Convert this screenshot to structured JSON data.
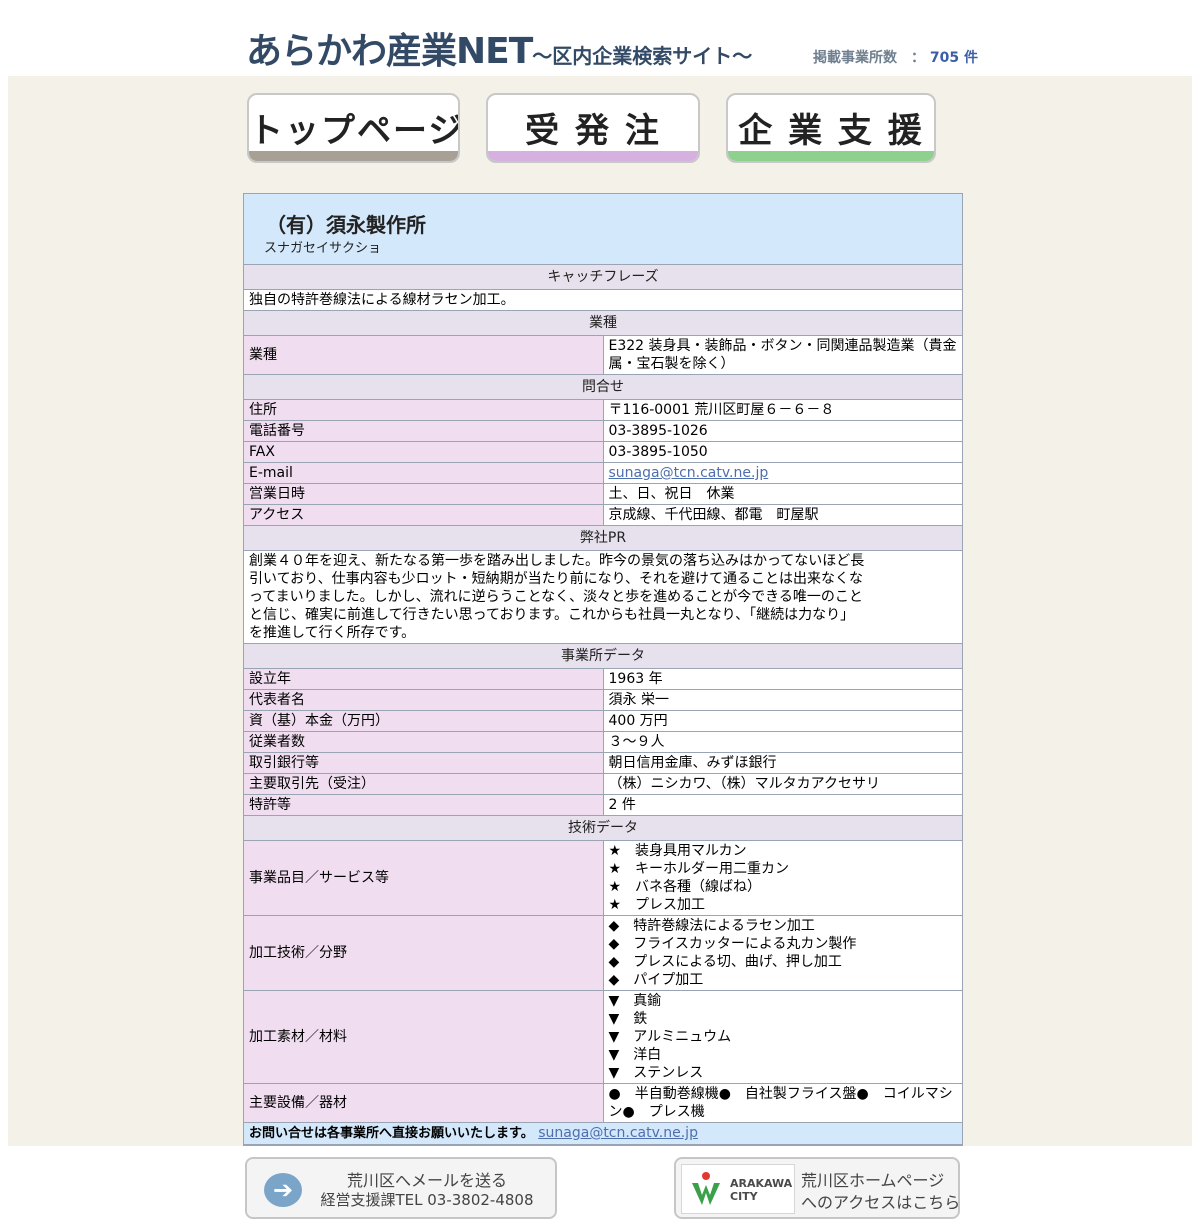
{
  "header": {
    "title_main": "あらかわ産業NET",
    "title_sub": "〜区内企業検索サイト〜",
    "count_label": "掲載事業所数　：",
    "count_value": "705 件"
  },
  "nav": {
    "top": "トップページ",
    "order": "受 発 注",
    "support": "企 業 支 援"
  },
  "company": {
    "name": "（有）須永製作所",
    "kana": "スナガセイサクショ"
  },
  "sections": {
    "catch": "キャッチフレーズ",
    "industry": "業種",
    "contact": "問合せ",
    "pr": "弊社PR",
    "office": "事業所データ",
    "tech": "技術データ"
  },
  "catchphrase": "独自の特許巻線法による線材ラセン加工。",
  "industry": {
    "label": "業種",
    "value": "E322 装身具・装飾品・ボタン・同関連品製造業（貴金属・宝石製を除く）"
  },
  "contact": {
    "address_label": "住所",
    "address": "〒116-0001 荒川区町屋６－６－８",
    "phone_label": "電話番号",
    "phone": "03-3895-1026",
    "fax_label": "FAX",
    "fax": "03-3895-1050",
    "email_label": "E-mail",
    "email": "sunaga@tcn.catv.ne.jp",
    "hours_label": "営業日時",
    "hours": "土、日、祝日　休業",
    "access_label": "アクセス",
    "access": "京成線、千代田線、都電　町屋駅"
  },
  "pr_lines": [
    "創業４０年を迎え、新たなる第一歩を踏み出しました。昨今の景気の落ち込みはかってないほど長",
    "引いており、仕事内容も少ロット・短納期が当たり前になり、それを避けて通ることは出来なくな",
    "ってまいりました。しかし、流れに逆らうことなく、淡々と歩を進めることが今できる唯一のこと",
    "と信じ、確実に前進して行きたい思っております。これからも社員一丸となり、「継続は力なり」",
    "を推進して行く所存です。"
  ],
  "office": {
    "founded_label": "設立年",
    "founded": "1963 年",
    "rep_label": "代表者名",
    "rep": "須永 栄一",
    "capital_label": "資（基）本金（万円）",
    "capital": "400 万円",
    "employees_label": "従業者数",
    "employees": "３～９人",
    "banks_label": "取引銀行等",
    "banks": "朝日信用金庫、みずほ銀行",
    "clients_label": "主要取引先（受注）",
    "clients": "（株）ニシカワ、（株）マルタカアクセサリ",
    "patents_label": "特許等",
    "patents": "2 件"
  },
  "tech": {
    "products_label": "事業品目／サービス等",
    "products": [
      "★　装身具用マルカン",
      "★　キーホルダー用二重カン",
      "★　バネ各種（線ばね）",
      "★　プレス加工"
    ],
    "processing_label": "加工技術／分野",
    "processing": [
      "◆　特許巻線法によるラセン加工",
      "◆　フライスカッターによる丸カン製作",
      "◆　プレスによる切、曲げ、押し加工",
      "◆　パイプ加工"
    ],
    "materials_label": "加工素材／材料",
    "materials": [
      "▼　真鍮",
      "▼　鉄",
      "▼　アルミニュウム",
      "▼　洋白",
      "▼　ステンレス"
    ],
    "equipment_label": "主要設備／器材",
    "equipment": "●　半自動巻線機●　自社製フライス盤●　コイルマシン●　プレス機"
  },
  "footer_note": "お問い合せは各事業所へ直接お願いいたします。",
  "footer_email": "sunaga@tcn.catv.ne.jp",
  "bottom": {
    "mail_line1": "荒川区へメールを送る",
    "mail_line2": "経営支援課TEL 03-3802-4808",
    "arrow": "➔",
    "city_logo_line1": "ARAKAWA",
    "city_logo_line2": "CITY",
    "city_line1": "荒川区ホームページ",
    "city_line2": "へのアクセスはこちら"
  },
  "colors": {
    "title": "#334a66",
    "section_bg": "#e6e1ec",
    "label_bg": "#f0def0",
    "header_bg": "#d4e8fb",
    "page_bg": "#f3f1e8",
    "link": "#4e6fae"
  }
}
